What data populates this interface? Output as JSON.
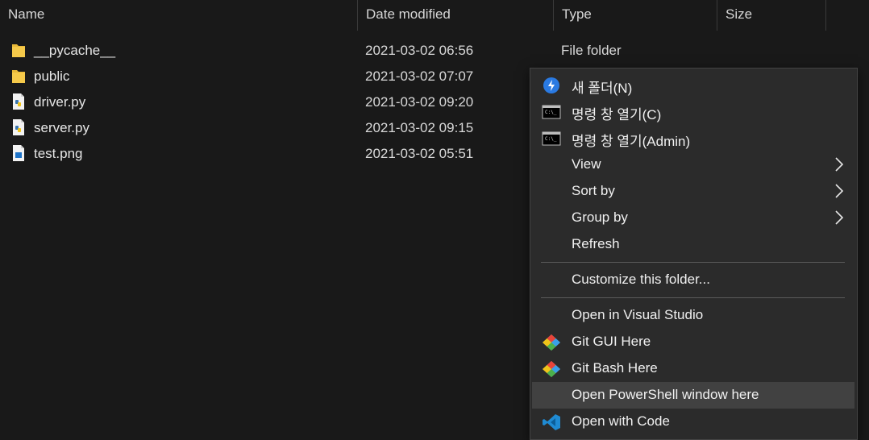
{
  "columns": {
    "name": "Name",
    "date": "Date modified",
    "type": "Type",
    "size": "Size"
  },
  "files": [
    {
      "name": "__pycache__",
      "date": "2021-03-02 06:56",
      "type": "File folder",
      "icon": "folder-icon"
    },
    {
      "name": "public",
      "date": "2021-03-02 07:07",
      "type": "",
      "icon": "folder-icon"
    },
    {
      "name": "driver.py",
      "date": "2021-03-02 09:20",
      "type": "",
      "icon": "python-file-icon"
    },
    {
      "name": "server.py",
      "date": "2021-03-02 09:15",
      "type": "",
      "icon": "python-file-icon"
    },
    {
      "name": "test.png",
      "date": "2021-03-02 05:51",
      "type": "",
      "icon": "image-file-icon"
    }
  ],
  "context_menu": {
    "items": [
      {
        "label": "새 폴더(N)",
        "icon": "new-folder-icon"
      },
      {
        "label": "명령 창 열기(C)",
        "icon": "cmd-icon"
      },
      {
        "label": "명령 창 열기(Admin)",
        "icon": "cmd-icon"
      },
      {
        "label": "View",
        "submenu": true
      },
      {
        "label": "Sort by",
        "submenu": true
      },
      {
        "label": "Group by",
        "submenu": true
      },
      {
        "label": "Refresh"
      },
      {
        "label": "Customize this folder..."
      },
      {
        "label": "Open in Visual Studio"
      },
      {
        "label": "Git GUI Here",
        "icon": "git-icon"
      },
      {
        "label": "Git Bash Here",
        "icon": "git-icon"
      },
      {
        "label": "Open PowerShell window here",
        "highlighted": true
      },
      {
        "label": "Open with Code",
        "icon": "vscode-icon"
      }
    ]
  },
  "colors": {
    "background": "#191919",
    "menu_background": "#2b2b2b",
    "menu_highlight": "#414141",
    "folder": "#e8b838"
  }
}
